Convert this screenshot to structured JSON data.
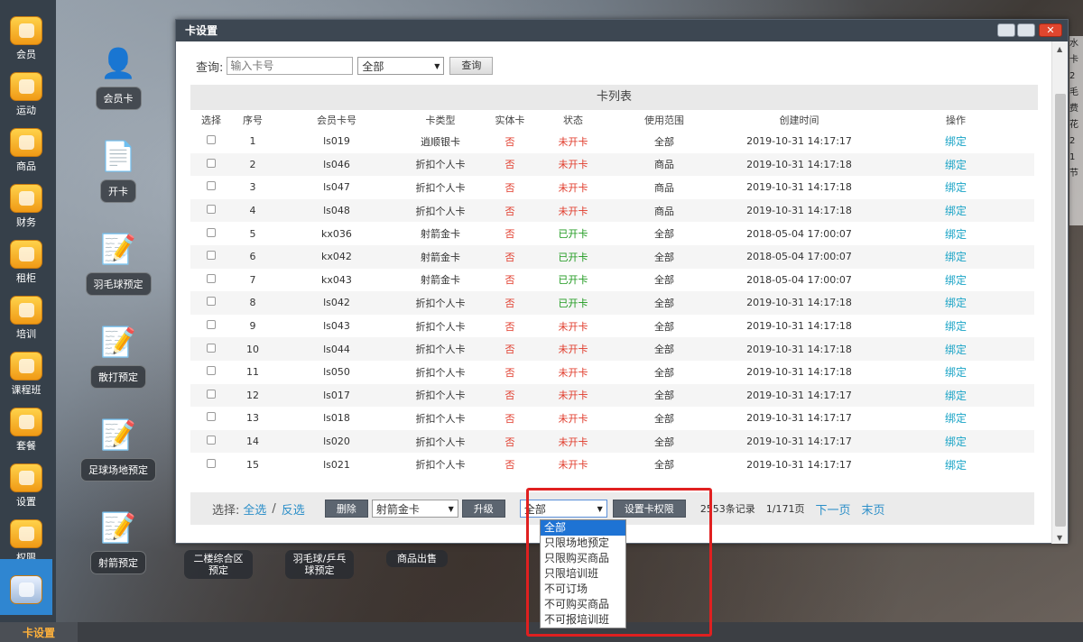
{
  "sidebar": {
    "items": [
      {
        "label": "会员",
        "icon": "person-icon"
      },
      {
        "label": "运动",
        "icon": "globe-icon"
      },
      {
        "label": "商品",
        "icon": "grid-icon"
      },
      {
        "label": "财务",
        "icon": "money-icon"
      },
      {
        "label": "租柜",
        "icon": "locker-icon"
      },
      {
        "label": "培训",
        "icon": "chart-icon"
      },
      {
        "label": "课程班",
        "icon": "chart-icon"
      },
      {
        "label": "套餐",
        "icon": "chart-icon"
      },
      {
        "label": "设置",
        "icon": "tools-icon"
      },
      {
        "label": "权限",
        "icon": "chart-icon"
      },
      {
        "label": "",
        "icon": "card-settings-icon"
      }
    ]
  },
  "bottom": {
    "current_tab": "卡设置"
  },
  "desktop": {
    "shortcuts": [
      "会员卡",
      "开卡",
      "羽毛球预定",
      "散打预定",
      "足球场地预定",
      "射箭预定"
    ],
    "chips": [
      "二楼综合区预定",
      "羽毛球/乒乓球预定",
      "商品出售"
    ]
  },
  "right_edge_text": [
    "水",
    "卡2",
    "毛",
    "费",
    "花2",
    "1",
    "节"
  ],
  "window": {
    "title": "卡设置",
    "query": {
      "label": "查询:",
      "placeholder": "输入卡号",
      "filter_value": "全部",
      "button": "查询"
    },
    "table": {
      "caption": "卡列表",
      "columns": [
        "选择",
        "序号",
        "会员卡号",
        "卡类型",
        "实体卡",
        "状态",
        "使用范围",
        "创建时间",
        "操作"
      ],
      "rows": [
        [
          "1",
          "ls019",
          "逍顺银卡",
          "否",
          "未开卡",
          "全部",
          "2019-10-31 14:17:17",
          "绑定"
        ],
        [
          "2",
          "ls046",
          "折扣个人卡",
          "否",
          "未开卡",
          "商品",
          "2019-10-31 14:17:18",
          "绑定"
        ],
        [
          "3",
          "ls047",
          "折扣个人卡",
          "否",
          "未开卡",
          "商品",
          "2019-10-31 14:17:18",
          "绑定"
        ],
        [
          "4",
          "ls048",
          "折扣个人卡",
          "否",
          "未开卡",
          "商品",
          "2019-10-31 14:17:18",
          "绑定"
        ],
        [
          "5",
          "kx036",
          "射箭金卡",
          "否",
          "已开卡",
          "全部",
          "2018-05-04 17:00:07",
          "绑定"
        ],
        [
          "6",
          "kx042",
          "射箭金卡",
          "否",
          "已开卡",
          "全部",
          "2018-05-04 17:00:07",
          "绑定"
        ],
        [
          "7",
          "kx043",
          "射箭金卡",
          "否",
          "已开卡",
          "全部",
          "2018-05-04 17:00:07",
          "绑定"
        ],
        [
          "8",
          "ls042",
          "折扣个人卡",
          "否",
          "已开卡",
          "全部",
          "2019-10-31 14:17:18",
          "绑定"
        ],
        [
          "9",
          "ls043",
          "折扣个人卡",
          "否",
          "未开卡",
          "全部",
          "2019-10-31 14:17:18",
          "绑定"
        ],
        [
          "10",
          "ls044",
          "折扣个人卡",
          "否",
          "未开卡",
          "全部",
          "2019-10-31 14:17:18",
          "绑定"
        ],
        [
          "11",
          "ls050",
          "折扣个人卡",
          "否",
          "未开卡",
          "全部",
          "2019-10-31 14:17:18",
          "绑定"
        ],
        [
          "12",
          "ls017",
          "折扣个人卡",
          "否",
          "未开卡",
          "全部",
          "2019-10-31 14:17:17",
          "绑定"
        ],
        [
          "13",
          "ls018",
          "折扣个人卡",
          "否",
          "未开卡",
          "全部",
          "2019-10-31 14:17:17",
          "绑定"
        ],
        [
          "14",
          "ls020",
          "折扣个人卡",
          "否",
          "未开卡",
          "全部",
          "2019-10-31 14:17:17",
          "绑定"
        ],
        [
          "15",
          "ls021",
          "折扣个人卡",
          "否",
          "未开卡",
          "全部",
          "2019-10-31 14:17:17",
          "绑定"
        ]
      ]
    },
    "footer": {
      "select_label": "选择:",
      "select_all": "全选",
      "sep": "/",
      "invert": "反选",
      "delete": "删除",
      "card_type_value": "射箭金卡",
      "upgrade": "升级",
      "scope_value": "全部",
      "set_perm": "设置卡权限",
      "records": "2553条记录",
      "page": "1/171页",
      "next": "下一页",
      "last": "末页"
    },
    "scope_options": [
      "全部",
      "只限场地预定",
      "只限购买商品",
      "只限培训班",
      "不可订场",
      "不可购买商品",
      "不可报培训班"
    ]
  }
}
